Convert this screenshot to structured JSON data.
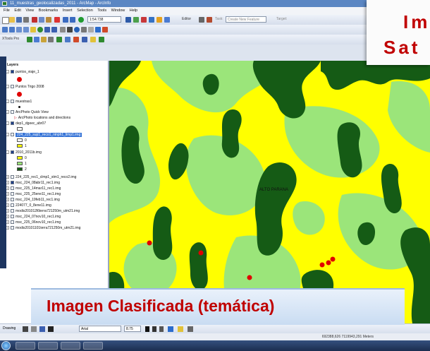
{
  "window": {
    "title": "11_muestras_geolocalizadas_2011 - ArcMap - ArcInfo"
  },
  "menu": [
    "File",
    "Edit",
    "View",
    "Bookmarks",
    "Insert",
    "Selection",
    "Tools",
    "Window",
    "Help"
  ],
  "toolbar": {
    "scale": "1:54.738",
    "editor_label": "Editor",
    "task_label": "Task:",
    "task_value": "Create New Feature",
    "target_label": "Target:",
    "xtools_label": "XTools Pro"
  },
  "toc": {
    "root": "Layers",
    "layers": [
      {
        "name": "puntos_viaje_1",
        "checked": true
      },
      {
        "name": "Puntos Trigo 2008",
        "checked": false
      },
      {
        "name": "muestras1",
        "checked": false
      },
      {
        "name": "ArcPhoto Quick View",
        "checked": false
      },
      {
        "name": "ArcPhoto locations and directions",
        "checked": false
      },
      {
        "name": "dep1_dgeec_abr07",
        "checked": true
      },
      {
        "name": "224_225_sup1_reco1_ninph1_limp1.img",
        "checked": false,
        "selected": true
      },
      {
        "name": "2010_2011b.img",
        "checked": true
      },
      {
        "name": "224_225_rec1_clmp1_stm1_reco2.img",
        "checked": false
      },
      {
        "name": "msc_224_08abr11_rec1.img",
        "checked": true
      },
      {
        "name": "msc_225_14mar11_rec1.img",
        "checked": false
      },
      {
        "name": "msc_225_25ene11_rec1.img",
        "checked": false
      },
      {
        "name": "msc_224_19feb11_rec1.img",
        "checked": false
      },
      {
        "name": "224077_0_8ene11.img",
        "checked": false
      },
      {
        "name": "modis201012l6terra721250m_utm21.img",
        "checked": false
      },
      {
        "name": "msc_224_07nov10_rec1.img",
        "checked": false
      },
      {
        "name": "msc_225_06nov10_rec1.img",
        "checked": false
      },
      {
        "name": "modis20101101terra721250m_utm21.img",
        "checked": false
      }
    ],
    "legend1": [
      {
        "value": "0",
        "color": "#ffffff"
      },
      {
        "value": "1",
        "color": "#ffff00"
      }
    ],
    "legend2": [
      {
        "value": "0",
        "color": "#ffff00"
      },
      {
        "value": "1",
        "color": "#9be57a"
      },
      {
        "value": "2",
        "color": "#155b15"
      }
    ]
  },
  "map": {
    "label": "ALTO PARANA",
    "colors": {
      "class0": "#ffff00",
      "class1": "#9be57a",
      "class2": "#155b15",
      "points": "#e00000"
    }
  },
  "drawing": {
    "label": "Drawing",
    "font": "Arial",
    "size": "8.75"
  },
  "status": {
    "coords": "692388,626 7119943,291 Meters"
  },
  "overlay": {
    "title_line1": "Im",
    "title_line2": "Sat",
    "caption": "Imagen Clasificada (temática)"
  }
}
